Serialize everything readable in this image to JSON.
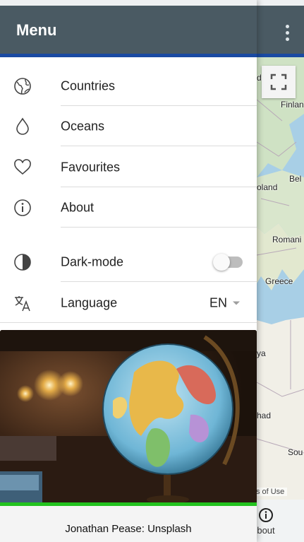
{
  "drawer": {
    "title": "Menu",
    "items": [
      {
        "label": "Countries",
        "icon": "globe-icon"
      },
      {
        "label": "Oceans",
        "icon": "water-drop-icon"
      },
      {
        "label": "Favourites",
        "icon": "heart-icon"
      },
      {
        "label": "About",
        "icon": "info-icon"
      }
    ],
    "settings": {
      "dark_mode_label": "Dark-mode",
      "dark_mode_on": false,
      "language_label": "Language",
      "language_value": "EN"
    },
    "photo_credit": "Jonathan Pease: Unsplash"
  },
  "map": {
    "labels": [
      "Finlan",
      "Bel",
      "oland",
      "Romani",
      "Greece",
      "ya",
      "had",
      "Sou",
      "de"
    ],
    "terms": "erms of Use"
  },
  "bottom_nav": {
    "about_label": "bout"
  },
  "colors": {
    "header": "#4a5a63",
    "accent": "#1a4aa2",
    "photo_bar": "#22c21e",
    "sea": "#a8cfe6"
  }
}
